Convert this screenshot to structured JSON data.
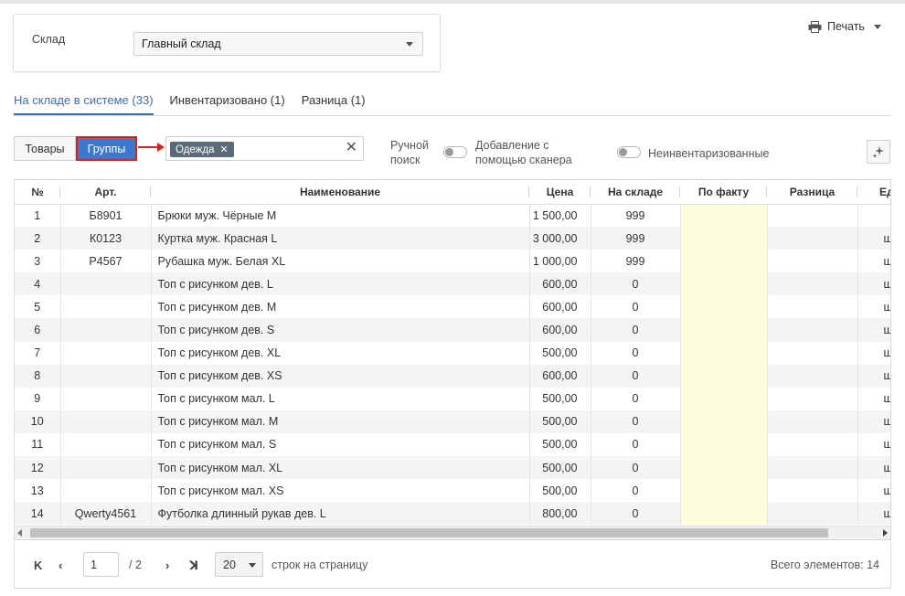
{
  "warehouse": {
    "label": "Склад",
    "value": "Главный склад"
  },
  "print": {
    "label": "Печать",
    "icon": "printer-icon"
  },
  "tabs": [
    {
      "label": "На складе в системе (33)",
      "active": true
    },
    {
      "label": "Инвентаризовано (1)",
      "active": false
    },
    {
      "label": "Разница (1)",
      "active": false
    }
  ],
  "filter": {
    "goods_label": "Товары",
    "groups_label": "Группы",
    "tag": "Одежда",
    "manual_search_line1": "Ручной",
    "manual_search_line2": "поиск",
    "scanner_line1": "Добавление с",
    "scanner_line2": "помощью сканера",
    "uninventoried": "Неинвентаризованные"
  },
  "table": {
    "headers": {
      "num": "№",
      "art": "Арт.",
      "name": "Наименование",
      "price": "Цена",
      "stock": "На складе",
      "fact": "По факту",
      "diff": "Разница",
      "unit": "Ед"
    },
    "rows": [
      {
        "num": "1",
        "art": "Б8901",
        "name": "Брюки муж. Чёрные M",
        "price": "1 500,00",
        "stock": "999",
        "fact": "",
        "diff": "",
        "unit": ""
      },
      {
        "num": "2",
        "art": "К0123",
        "name": "Куртка муж. Красная L",
        "price": "3 000,00",
        "stock": "999",
        "fact": "",
        "diff": "",
        "unit": "ш"
      },
      {
        "num": "3",
        "art": "Р4567",
        "name": "Рубашка муж. Белая XL",
        "price": "1 000,00",
        "stock": "999",
        "fact": "",
        "diff": "",
        "unit": "ш"
      },
      {
        "num": "4",
        "art": "",
        "name": "Топ с рисунком дев. L",
        "price": "600,00",
        "stock": "0",
        "fact": "",
        "diff": "",
        "unit": "ш"
      },
      {
        "num": "5",
        "art": "",
        "name": "Топ с рисунком дев. M",
        "price": "600,00",
        "stock": "0",
        "fact": "",
        "diff": "",
        "unit": "ш"
      },
      {
        "num": "6",
        "art": "",
        "name": "Топ с рисунком дев. S",
        "price": "600,00",
        "stock": "0",
        "fact": "",
        "diff": "",
        "unit": "ш"
      },
      {
        "num": "7",
        "art": "",
        "name": "Топ с рисунком дев. XL",
        "price": "500,00",
        "stock": "0",
        "fact": "",
        "diff": "",
        "unit": "ш"
      },
      {
        "num": "8",
        "art": "",
        "name": "Топ с рисунком дев. XS",
        "price": "600,00",
        "stock": "0",
        "fact": "",
        "diff": "",
        "unit": "ш"
      },
      {
        "num": "9",
        "art": "",
        "name": "Топ с рисунком мал. L",
        "price": "500,00",
        "stock": "0",
        "fact": "",
        "diff": "",
        "unit": "ш"
      },
      {
        "num": "10",
        "art": "",
        "name": "Топ с рисунком мал. M",
        "price": "500,00",
        "stock": "0",
        "fact": "",
        "diff": "",
        "unit": "ш"
      },
      {
        "num": "11",
        "art": "",
        "name": "Топ с рисунком мал. S",
        "price": "500,00",
        "stock": "0",
        "fact": "",
        "diff": "",
        "unit": "ш"
      },
      {
        "num": "12",
        "art": "",
        "name": "Топ с рисунком мал. XL",
        "price": "500,00",
        "stock": "0",
        "fact": "",
        "diff": "",
        "unit": "ш"
      },
      {
        "num": "13",
        "art": "",
        "name": "Топ с рисунком мал. XS",
        "price": "500,00",
        "stock": "0",
        "fact": "",
        "diff": "",
        "unit": "ш"
      },
      {
        "num": "14",
        "art": "Qwerty4561",
        "name": "Футболка длинный рукав дев. L",
        "price": "800,00",
        "stock": "0",
        "fact": "",
        "diff": "",
        "unit": "ш"
      }
    ]
  },
  "pager": {
    "current_page": "1",
    "total_pages": "/  2",
    "per_page": "20",
    "per_page_label": "строк на страницу",
    "total_label": "Всего элементов: 14"
  },
  "colors": {
    "accent": "#3a6bc0",
    "groups_button": "#3d78d0",
    "highlight_border": "#d42323",
    "fact_column": "#fdfddd"
  }
}
